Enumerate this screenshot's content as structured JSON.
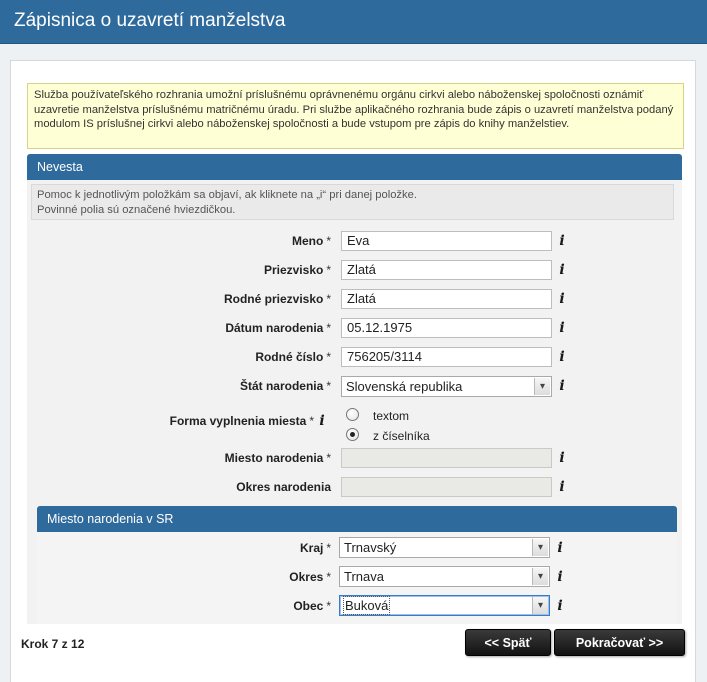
{
  "page": {
    "title": "Zápisnica o uzavretí manželstva"
  },
  "info": "Služba používateľského rozhrania umožní príslušnému oprávnenému orgánu cirkvi alebo náboženskej spoločnosti oznámiť uzavretie manželstva príslušnému matričnému úradu. Pri službe aplikačného rozhrania bude zápis o uzavretí manželstva podaný modulom IS príslušnej cirkvi alebo náboženskej spoločnosti a bude vstupom pre zápis do knihy manželstiev.",
  "section": {
    "title": "Nevesta",
    "help_line1": "Pomoc k jednotlivým položkám sa objaví, ak kliknete na „i“ pri danej položke.",
    "help_line2": "Povinné polia sú označené hviezdičkou."
  },
  "fields": {
    "meno": {
      "label": "Meno",
      "value": "Eva"
    },
    "priezvisko": {
      "label": "Priezvisko",
      "value": "Zlatá"
    },
    "rodne_priezvisko": {
      "label": "Rodné priezvisko",
      "value": "Zlatá"
    },
    "datum_narodenia": {
      "label": "Dátum narodenia",
      "value": "05.12.1975"
    },
    "rodne_cislo": {
      "label": "Rodné číslo",
      "value": "756205/3114"
    },
    "stat_narodenia": {
      "label": "Štát narodenia",
      "value": "Slovenská republika"
    },
    "forma": {
      "label": "Forma vyplnenia miesta",
      "option1": "textom",
      "option2": "z číselníka",
      "selected": "z číselníka"
    },
    "miesto_narodenia": {
      "label": "Miesto narodenia",
      "value": ""
    },
    "okres_narodenia": {
      "label": "Okres narodenia",
      "value": ""
    }
  },
  "subsection": {
    "title": "Miesto narodenia v SR",
    "kraj": {
      "label": "Kraj",
      "value": "Trnavský"
    },
    "okres": {
      "label": "Okres",
      "value": "Trnava"
    },
    "obec": {
      "label": "Obec",
      "value": "Buková"
    }
  },
  "required_mark": "*",
  "info_icon_glyph": "i",
  "dropdown_glyph": "▾",
  "footer": {
    "step": "Krok 7 z 12",
    "back": "<< Späť",
    "next": "Pokračovať >>"
  },
  "colors": {
    "header": "#2f6a9c",
    "info_bg": "#ffffd6",
    "button": "#1a1a1a"
  }
}
